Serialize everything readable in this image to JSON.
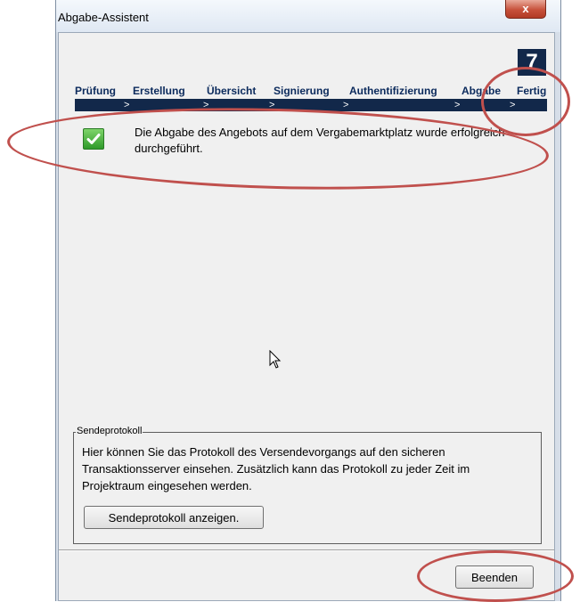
{
  "window": {
    "title": "Abgabe-Assistent",
    "close_label": "x"
  },
  "wizard": {
    "step_number": "7",
    "steps": [
      {
        "label": "Prüfung"
      },
      {
        "label": "Erstellung"
      },
      {
        "label": "Übersicht"
      },
      {
        "label": "Signierung"
      },
      {
        "label": "Authentifizierung"
      },
      {
        "label": "Abgabe"
      },
      {
        "label": "Fertig"
      }
    ]
  },
  "result": {
    "icon": "check-icon",
    "message": "Die Abgabe des Angebots auf dem Vergabemarktplatz wurde erfolgreich durchgeführt."
  },
  "protocol": {
    "legend": "Sendeprotokoll",
    "text": "Hier können Sie das Protokoll des Versendevorgangs auf den sicheren Transaktionsserver einsehen. Zusätzlich kann das Protokoll zu jeder Zeit im Projektraum eingesehen werden.",
    "button_label": "Sendeprotokoll anzeigen."
  },
  "footer": {
    "finish_label": "Beenden"
  },
  "colors": {
    "accent": "#12284a",
    "annotation": "#c0504d",
    "success": "#3ea834"
  }
}
